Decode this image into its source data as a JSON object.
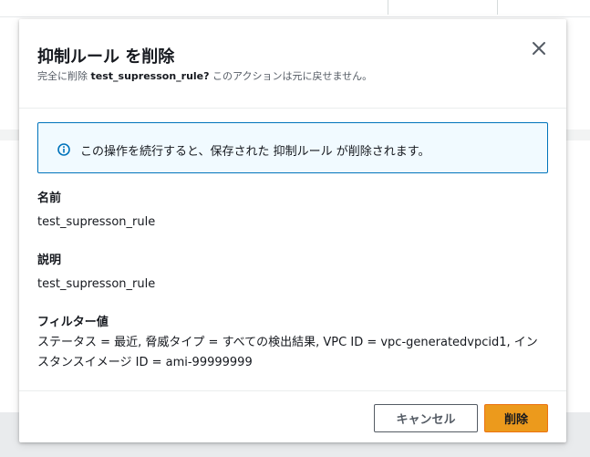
{
  "modal": {
    "title": "抑制ルール を削除",
    "subtitle_prefix": "完全に削除 ",
    "subtitle_rule": "test_supresson_rule?",
    "subtitle_suffix": " このアクションは元に戻せません。",
    "close_icon": "close-icon"
  },
  "alert": {
    "icon": "info-icon",
    "text": "この操作を続行すると、保存された 抑制ルール が削除されます。",
    "accent_color": "#0073bb"
  },
  "fields": {
    "name_label": "名前",
    "name_value": "test_supresson_rule",
    "description_label": "説明",
    "description_value": "test_supresson_rule",
    "filter_label": "フィルター値",
    "filter_value": "ステータス = 最近, 脅威タイプ = すべての検出結果, VPC ID = vpc-generatedvpcid1, インスタンスイメージ ID = ami-99999999"
  },
  "footer": {
    "cancel_label": "キャンセル",
    "delete_label": "削除",
    "primary_color": "#ec9a1c"
  }
}
